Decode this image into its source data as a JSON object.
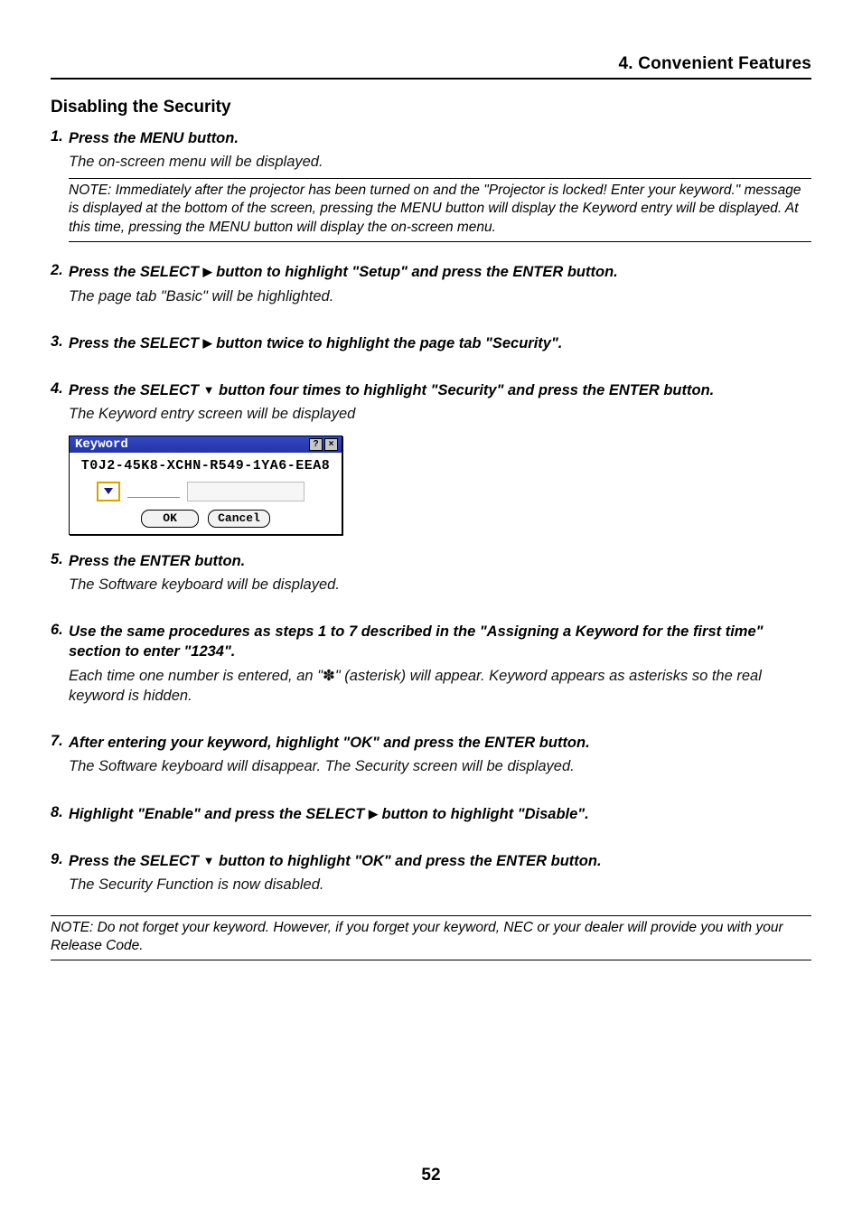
{
  "header": {
    "chapter": "4. Convenient Features"
  },
  "section_title": "Disabling the Security",
  "steps": [
    {
      "num": "1.",
      "title": "Press the MENU button.",
      "desc": "The on-screen menu will be displayed.",
      "note": "NOTE: Immediately after the projector has been turned on and the \"Projector is locked! Enter your keyword.\" message is displayed at the bottom of the screen, pressing the MENU button will display the Keyword entry will be displayed. At this time, pressing the MENU button will display the on-screen menu."
    },
    {
      "num": "2.",
      "title_pre": "Press the SELECT ",
      "title_post": " button to highlight \"Setup\" and press the ENTER button.",
      "arrow": "right",
      "desc": "The page tab \"Basic\" will be highlighted."
    },
    {
      "num": "3.",
      "title_pre": "Press the SELECT ",
      "title_post": " button twice to highlight the page tab \"Security\".",
      "arrow": "right"
    },
    {
      "num": "4.",
      "title_pre": "Press the SELECT ",
      "title_post": " button four times to highlight \"Security\" and press the ENTER button.",
      "arrow": "down",
      "desc": "The Keyword entry screen will be displayed"
    },
    {
      "num": "5.",
      "title": "Press the ENTER button.",
      "desc": "The Software keyboard will be displayed."
    },
    {
      "num": "6.",
      "title": "Use the same procedures as steps 1 to 7 described in the \"Assigning a Keyword for the first time\" section to enter \"1234\".",
      "desc_pre": "Each time one number is entered, an \"",
      "desc_post": "\" (asterisk) will appear. Keyword appears as asterisks so the real keyword is hidden.",
      "asterisk": "✽"
    },
    {
      "num": "7.",
      "title": "After entering your keyword, highlight \"OK\" and press the ENTER button.",
      "desc": "The Software keyboard will disappear. The Security screen will be displayed."
    },
    {
      "num": "8.",
      "title_pre": "Highlight \"Enable\" and press the SELECT ",
      "title_post": " button to highlight \"Disable\".",
      "arrow": "right"
    },
    {
      "num": "9.",
      "title_pre": "Press the SELECT ",
      "title_post": " button to highlight \"OK\" and press the ENTER button.",
      "arrow": "down",
      "desc": "The Security Function is now disabled."
    }
  ],
  "dialog": {
    "title": "Keyword",
    "serial": "T0J2-45K8-XCHN-R549-1YA6-EEA8",
    "ok": "OK",
    "cancel": "Cancel"
  },
  "footer_note": "NOTE: Do not forget your keyword. However, if you forget your keyword, NEC or your dealer will provide you with your Release Code.",
  "page_number": "52"
}
